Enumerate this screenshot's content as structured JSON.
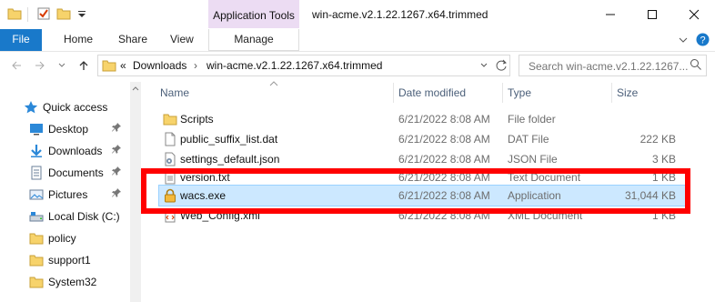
{
  "window": {
    "title": "win-acme.v2.1.22.1267.x64.trimmed",
    "contextual_group": "Application Tools"
  },
  "ribbon": {
    "tabs": [
      "File",
      "Home",
      "Share",
      "View"
    ],
    "manage": "Manage"
  },
  "address": {
    "overflow": "«",
    "crumbs": [
      "Downloads",
      "win-acme.v2.1.22.1267.x64.trimmed"
    ],
    "separator": "›",
    "search_placeholder": "Search win-acme.v2.1.22.1267..."
  },
  "sidebar": {
    "items": [
      {
        "label": "Quick access",
        "icon": "star-icon",
        "pinned": false
      },
      {
        "label": "Desktop",
        "icon": "desktop-icon",
        "pinned": true
      },
      {
        "label": "Downloads",
        "icon": "download-arrow-icon",
        "pinned": true
      },
      {
        "label": "Documents",
        "icon": "documents-icon",
        "pinned": true
      },
      {
        "label": "Pictures",
        "icon": "pictures-icon",
        "pinned": true
      },
      {
        "label": "Local Disk (C:)",
        "icon": "drive-icon",
        "pinned": false
      },
      {
        "label": "policy",
        "icon": "folder-icon",
        "pinned": false
      },
      {
        "label": "support1",
        "icon": "folder-icon",
        "pinned": false
      },
      {
        "label": "System32",
        "icon": "folder-icon",
        "pinned": false
      }
    ]
  },
  "files": {
    "columns": [
      "Name",
      "Date modified",
      "Type",
      "Size"
    ],
    "rows": [
      {
        "name": "Scripts",
        "date": "6/21/2022 8:08 AM",
        "type": "File folder",
        "size": "",
        "icon": "folder-icon"
      },
      {
        "name": "public_suffix_list.dat",
        "date": "6/21/2022 8:08 AM",
        "type": "DAT File",
        "size": "222 KB",
        "icon": "file-icon"
      },
      {
        "name": "settings_default.json",
        "date": "6/21/2022 8:08 AM",
        "type": "JSON File",
        "size": "3 KB",
        "icon": "json-file-icon"
      },
      {
        "name": "version.txt",
        "date": "6/21/2022 8:08 AM",
        "type": "Text Document",
        "size": "1 KB",
        "icon": "text-file-icon"
      },
      {
        "name": "wacs.exe",
        "date": "6/21/2022 8:08 AM",
        "type": "Application",
        "size": "31,044 KB",
        "icon": "lock-app-icon"
      },
      {
        "name": "Web_Config.xml",
        "date": "6/21/2022 8:08 AM",
        "type": "XML Document",
        "size": "1 KB",
        "icon": "xml-file-icon"
      }
    ]
  },
  "colors": {
    "file_tab": "#1979ca",
    "app_tools": "#ecdcf3",
    "selection": "#cce8ff",
    "annotation": "#ff0000"
  }
}
